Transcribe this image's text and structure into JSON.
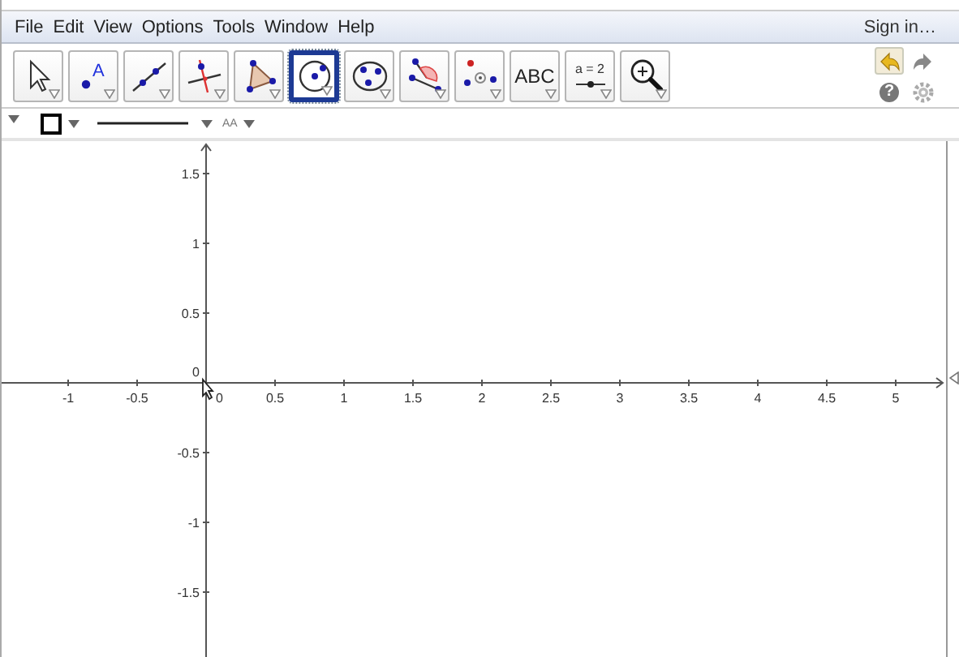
{
  "menu": [
    "File",
    "Edit",
    "View",
    "Options",
    "Tools",
    "Window",
    "Help"
  ],
  "sign_in": "Sign in…",
  "tools": [
    {
      "kind": "move",
      "selected": false
    },
    {
      "kind": "point",
      "label": "A",
      "selected": false
    },
    {
      "kind": "line",
      "selected": false
    },
    {
      "kind": "perpendicular",
      "selected": false
    },
    {
      "kind": "polygon",
      "selected": false
    },
    {
      "kind": "circle",
      "selected": true
    },
    {
      "kind": "circle3",
      "selected": false
    },
    {
      "kind": "angle",
      "selected": false
    },
    {
      "kind": "reflect",
      "selected": false
    },
    {
      "kind": "text",
      "label": "ABC",
      "selected": false
    },
    {
      "kind": "slider",
      "label": "a = 2",
      "selected": false
    },
    {
      "kind": "zoom",
      "selected": false
    }
  ],
  "help": "?",
  "style_bar": {
    "text_size": "AA"
  },
  "graphics": {
    "x_labels": [
      "-1",
      "-0.5",
      "0",
      "0.5",
      "1",
      "1.5",
      "2",
      "2.5",
      "3",
      "3.5",
      "4",
      "4.5",
      "5"
    ],
    "y_labels": [
      "1.5",
      "1",
      "0.5",
      "0",
      "-0.5",
      "-1",
      "-1.5"
    ]
  }
}
